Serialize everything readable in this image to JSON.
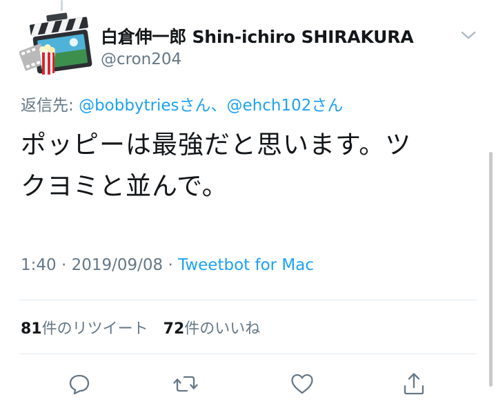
{
  "tweet": {
    "display_name": "白倉伸一郎 Shin-ichiro SHIRAKURA",
    "handle": "@cron204",
    "reply_prefix": "返信先: ",
    "reply_mention_1": "@bobbytries",
    "reply_suffix_1": "さん、",
    "reply_mention_2": "@ehch102",
    "reply_suffix_2": "さん",
    "text_line_1": "ポッピーは最強だと思います。ツ",
    "text_line_2": "クヨミと並んで。",
    "time": "1:40 · 2019/09/08 · ",
    "client": "Tweetbot for Mac"
  },
  "stats": {
    "retweets_count": "81",
    "retweets_label": "件のリツイート",
    "likes_count": "72",
    "likes_label": "件のいいね"
  },
  "icons": {
    "avatar": "clapperboard-popcorn-app-icon",
    "menu": "chevron-down-icon",
    "reply": "reply-bubble-icon",
    "retweet": "retweet-icon",
    "like": "heart-icon",
    "share": "share-upload-icon"
  },
  "colors": {
    "primary_text": "#14171a",
    "secondary_text": "#657786",
    "link": "#1da1f2",
    "divider": "#e1e8ed"
  }
}
